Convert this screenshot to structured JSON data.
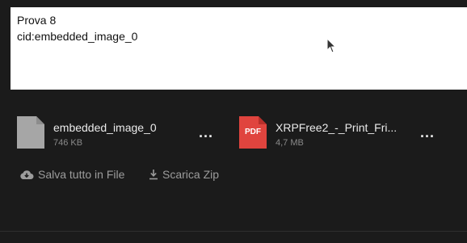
{
  "message": {
    "line1": "Prova 8",
    "line2": "cid:embedded_image_0"
  },
  "attachments": [
    {
      "name": "embedded_image_0",
      "size": "746 KB",
      "icon": "generic-file-icon"
    },
    {
      "name": "XRPFree2_-_Print_Fri...",
      "size": "4,7 MB",
      "icon": "pdf-file-icon",
      "icon_label": "PDF"
    }
  ],
  "more_label": "...",
  "actions": {
    "save_all": "Salva tutto in File",
    "download_zip": "Scarica Zip"
  },
  "colors": {
    "background": "#1b1b1b",
    "pdf_red": "#e0443e",
    "file_gray": "#a6a6a6"
  }
}
